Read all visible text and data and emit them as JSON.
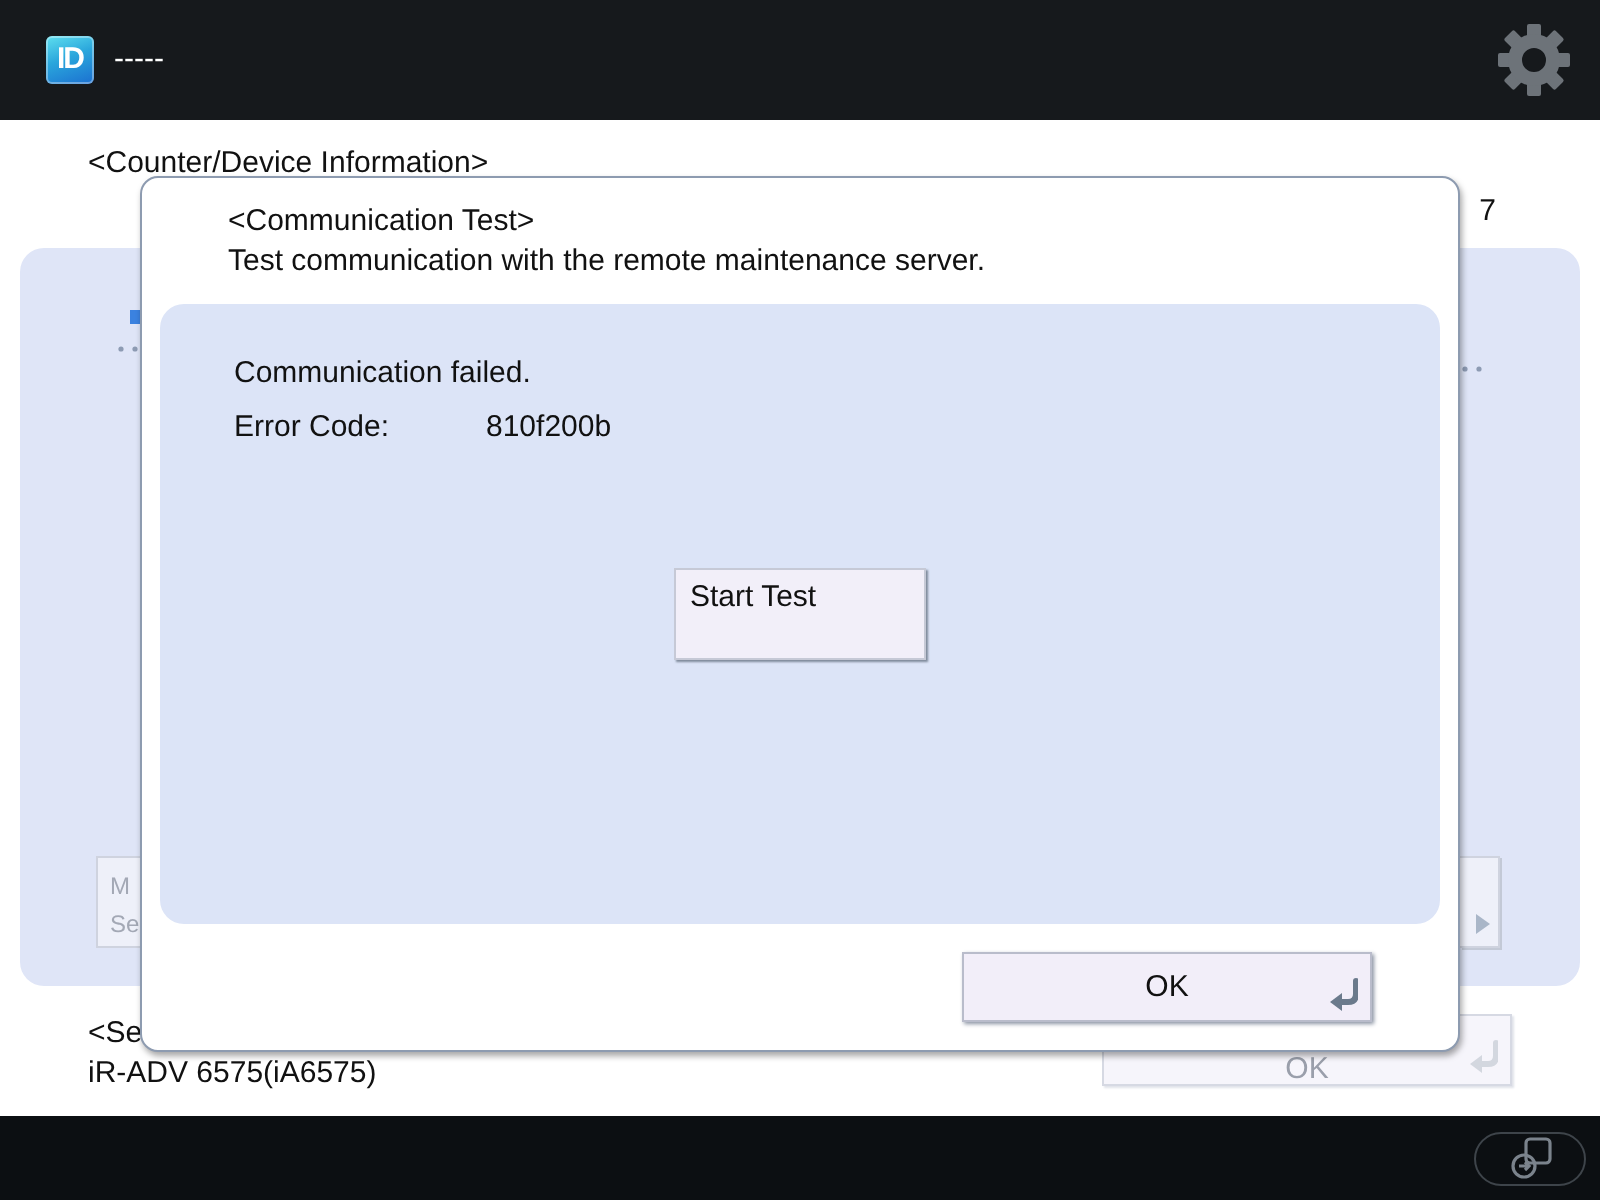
{
  "top_bar": {
    "logo_text": "ID",
    "user": "-----"
  },
  "page": {
    "title": "<Counter/Device Information>",
    "page_number": "7",
    "panel": {
      "left_button": {
        "lines": [
          "M",
          "Se"
        ],
        "disabled": true
      },
      "right_button": {
        "disabled": true
      }
    },
    "section_label": "<Se",
    "model": "iR-ADV 6575(iA6575)",
    "ok_button": {
      "label": "OK",
      "disabled": true
    }
  },
  "dialog": {
    "title": "<Communication Test>",
    "description": "Test communication with the remote maintenance server.",
    "status": "Communication failed.",
    "error_code_label": "Error Code:",
    "error_code": "810f200b",
    "start_button": "Start Test",
    "ok_button": "OK"
  }
}
